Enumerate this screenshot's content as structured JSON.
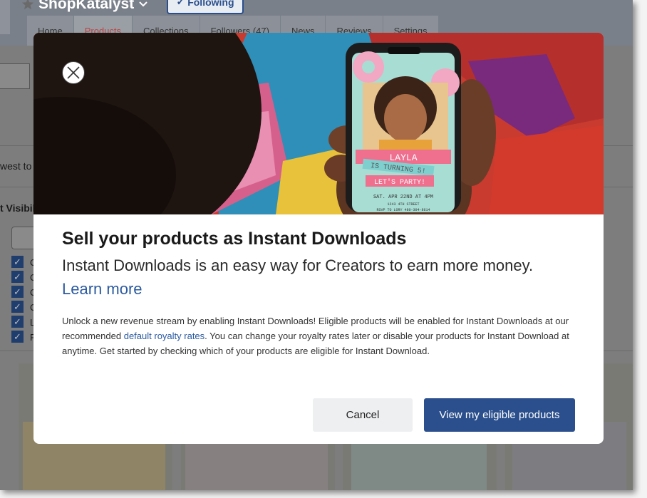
{
  "store": {
    "name": "ShopKatalyst",
    "following_label": "Following"
  },
  "tabs": [
    {
      "label": "Home"
    },
    {
      "label": "Products"
    },
    {
      "label": "Collections"
    },
    {
      "label": "Followers (47)"
    },
    {
      "label": "News"
    },
    {
      "label": "Reviews"
    },
    {
      "label": "Settings"
    }
  ],
  "background_page": {
    "sort_fragment": "west to",
    "visibility_fragment": "t Visibil",
    "checkbox_fragments": [
      "C",
      "C",
      "C",
      "C",
      "L",
      "R"
    ]
  },
  "modal": {
    "title": "Sell your products as Instant Downloads",
    "subtitle": "Instant Downloads is an easy way for Creators to earn more money.",
    "learn_more": "Learn more",
    "body_part1": "Unlock a new revenue stream by enabling Instant Downloads! Eligible products will be enabled for Instant Downloads at our recommended ",
    "body_link": "default royalty rates",
    "body_part2": ". You can change your royalty rates later or disable your products for Instant Download at anytime. Get started by checking which of your products are eligible for Instant Download.",
    "cancel_label": "Cancel",
    "primary_label": "View my eligible products"
  },
  "hero_invite": {
    "name": "LAYLA",
    "line1": "IS TURNING 5!",
    "line2": "LET'S PARTY!",
    "date": "SAT. APR 22ND AT 4PM",
    "address": "1243 4TH STREET",
    "rsvp": "RSVP TO LORY 480-304-8614"
  },
  "colors": {
    "primary": "#2a4f8c",
    "link": "#2c5aa0",
    "overlay_header": "#7a808a"
  }
}
